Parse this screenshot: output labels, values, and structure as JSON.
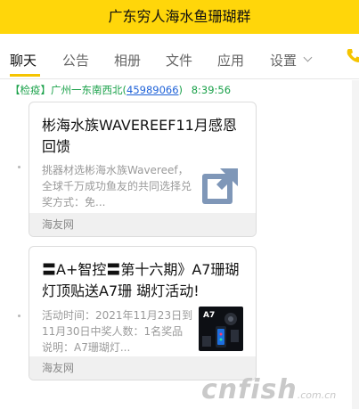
{
  "window": {
    "title": "广东穷人海水鱼珊瑚群"
  },
  "tabs": [
    {
      "label": "聊天",
      "active": true
    },
    {
      "label": "公告"
    },
    {
      "label": "相册"
    },
    {
      "label": "文件"
    },
    {
      "label": "应用"
    },
    {
      "label": "设置"
    }
  ],
  "system_message": {
    "prefix": "【检疫】广州一东南西北(",
    "qq": "45989066",
    "suffix": ")",
    "time": "8:39:56"
  },
  "messages": [
    {
      "title": "彬海水族WAVEREEF11月感恩回馈",
      "desc": "挑器材选彬海水族Wavereef，全球千万成功鱼友的共同选择兑奖方式：免...",
      "source": "海友网",
      "thumb_icon": "share-link-icon"
    },
    {
      "title": "〓A+智控〓第十六期》A7珊瑚灯顶贴送A7珊 瑚灯活动!",
      "desc": "活动时间：2021年11月23日到11月30日中奖人数：1名奖品说明：A7珊瑚灯...",
      "source": "海友网",
      "thumb_icon": "a7-lamp-thumbnail",
      "thumb_text": "A7"
    }
  ],
  "watermark": {
    "text": "cnfish",
    "suffix": ".com.cn"
  },
  "colors": {
    "titlebar": "#ffd60a",
    "accent_underline": "#f5c400",
    "system_green": "#1aa14a",
    "link_blue": "#1f62d8"
  }
}
